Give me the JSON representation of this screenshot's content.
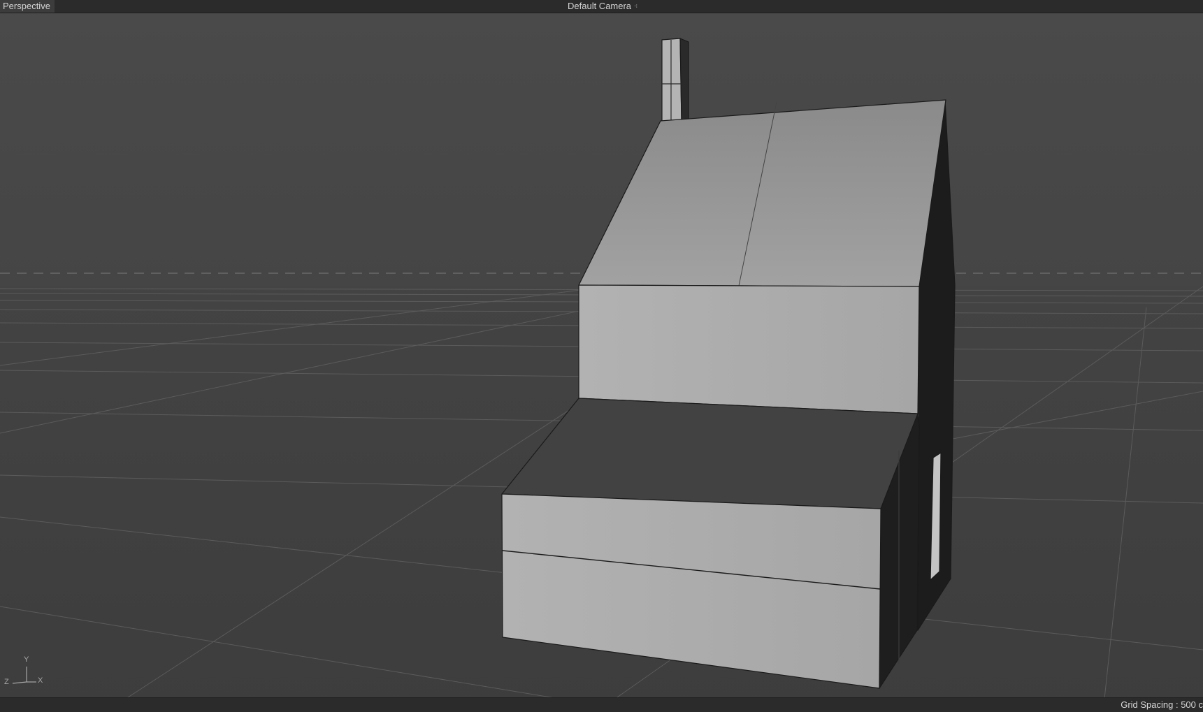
{
  "viewport": {
    "view_name": "Perspective",
    "camera_label": "Default Camera",
    "camera_icon": "camera-dots-icon"
  },
  "status_bar": {
    "grid_spacing": "Grid Spacing : 500 c"
  },
  "axis_gizmo": {
    "y": "Y",
    "z": "Z",
    "x": "X"
  },
  "colors": {
    "background": "#454545",
    "grid": "#5a5a5a",
    "model_light": "#b0b0b0",
    "model_dark": "#1c1c1c"
  }
}
